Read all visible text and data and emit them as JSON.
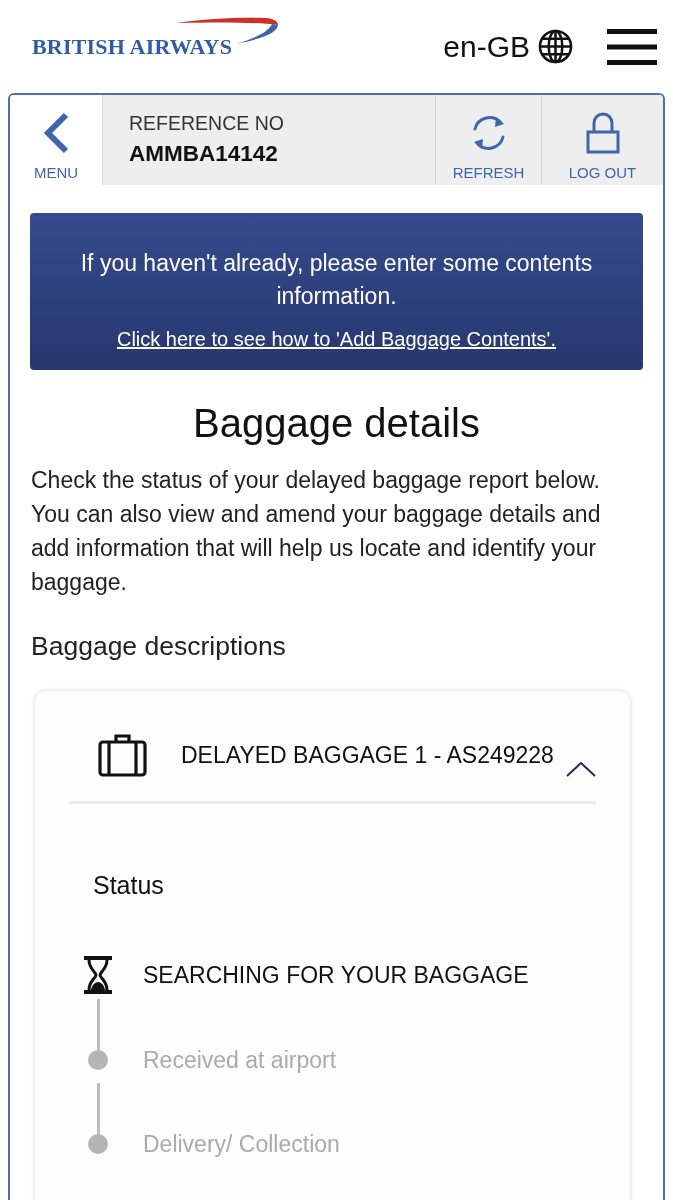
{
  "header": {
    "logo": "BRITISH AIRWAYS",
    "language": "en-GB"
  },
  "nav": {
    "menu": "MENU",
    "reference_label": "REFERENCE NO",
    "reference_number": "AMMBA14142",
    "actions": [
      {
        "kind": "refresh",
        "label": "REFRESH"
      },
      {
        "kind": "logout",
        "label": "LOG OUT"
      }
    ]
  },
  "notice": {
    "message": "If you haven't already, please enter some contents information.",
    "link": "Click here to see how to 'Add Baggage Contents'."
  },
  "title": "Baggage details",
  "intro": "Check the status of your delayed baggage report below. You can also view and amend your baggage details and add information that will help us locate and identify your baggage.",
  "section_title": "Baggage descriptions",
  "baggage": [
    {
      "title": "DELAYED BAGGAGE 1 - AS249228",
      "expanded": true,
      "status_label": "Status",
      "steps": [
        {
          "label": "SEARCHING FOR YOUR BAGGAGE",
          "active": true
        },
        {
          "label": "Received at airport",
          "active": false
        },
        {
          "label": "Delivery/ Collection",
          "active": false
        }
      ]
    }
  ]
}
